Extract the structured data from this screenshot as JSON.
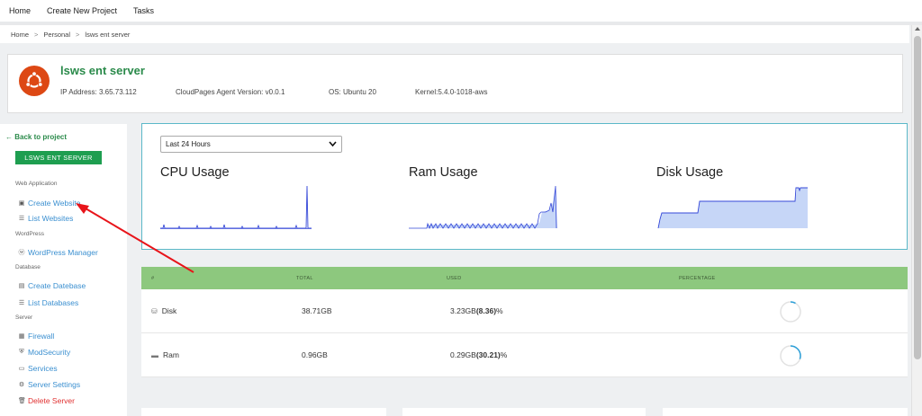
{
  "topnav": {
    "items": [
      "Home",
      "Create New Project",
      "Tasks"
    ]
  },
  "breadcrumb": {
    "items": [
      "Home",
      "Personal",
      "lsws ent server"
    ],
    "separator": ">"
  },
  "server": {
    "name": "lsws ent server",
    "ip_label": "IP Address: 3.65.73.112",
    "agent_label": "CloudPages Agent Version: v0.0.1",
    "os_label": "OS: Ubuntu 20",
    "kernel_label": "Kernel:5.4.0-1018-aws",
    "logo_icon": "ubuntu-logo-icon",
    "title_color": "#2a8a4a"
  },
  "sidebar": {
    "back_label": "Back to project",
    "server_button": "LSWS ENT SERVER",
    "sections": {
      "web_app": "Web Application",
      "wordpress": "WordPress",
      "database": "Database",
      "server": "Server"
    },
    "items": {
      "create_website": "Create Website",
      "list_websites": "List Websites",
      "wp_manager": "WordPress Manager",
      "create_db": "Create Datebase",
      "list_db": "List Databases",
      "firewall": "Firewall",
      "modsecurity": "ModSecurity",
      "services": "Services",
      "server_settings": "Server Settings",
      "delete_server": "Delete Server"
    },
    "accent_color": "#1e9e50",
    "link_color": "#3a8fd0",
    "danger_color": "#e03030"
  },
  "usage": {
    "range_selected": "Last 24 Hours",
    "cpu_title": "CPU Usage",
    "ram_title": "Ram Usage",
    "disk_title": "Disk Usage",
    "border_color": "#5bb8c8"
  },
  "resources": {
    "headers": [
      "#",
      "TOTAL",
      "USED",
      "PERCENTAGE"
    ],
    "header_color": "#8dc87e",
    "rows": [
      {
        "name": "Disk",
        "icon": "hdd-icon",
        "total": "38.71GB",
        "used": "3.23GB",
        "used_pct": "(8.36)",
        "pct_suffix": "%",
        "percentage": 8.36
      },
      {
        "name": "Ram",
        "icon": "memory-icon",
        "total": "0.96GB",
        "used": "0.29GB",
        "used_pct": "(30.21)",
        "pct_suffix": "%",
        "percentage": 30.21
      }
    ]
  }
}
